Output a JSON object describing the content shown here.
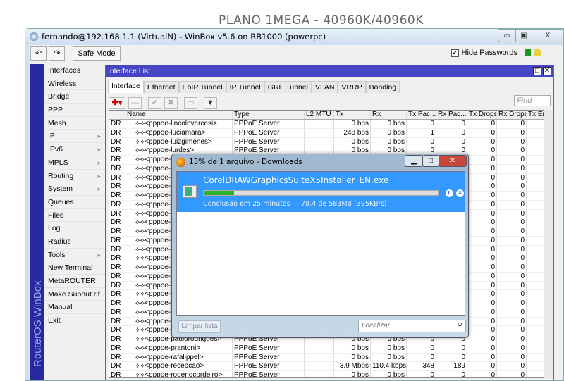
{
  "banner": "PLANO 1MEGA - 40960K/40960K",
  "window": {
    "title": "fernando@192.168.1.1 (VirtualN) - WinBox v5.6 on RB1000 (powerpc)",
    "min": "▭",
    "max": "▣",
    "close": "X"
  },
  "toolbar": {
    "undo": "↶",
    "redo": "↷",
    "safe_mode": "Safe Mode",
    "hide_passwords": "Hide Passwords",
    "check": "✔"
  },
  "side_label": "RouterOS WinBox",
  "menu": [
    {
      "label": "Interfaces"
    },
    {
      "label": "Wireless"
    },
    {
      "label": "Bridge"
    },
    {
      "label": "PPP"
    },
    {
      "label": "Mesh"
    },
    {
      "label": "IP",
      "sub": "▸"
    },
    {
      "label": "IPv6",
      "sub": "▸"
    },
    {
      "label": "MPLS",
      "sub": "▸"
    },
    {
      "label": "Routing",
      "sub": "▸"
    },
    {
      "label": "System",
      "sub": "▸"
    },
    {
      "label": "Queues"
    },
    {
      "label": "Files"
    },
    {
      "label": "Log"
    },
    {
      "label": "Radius"
    },
    {
      "label": "Tools",
      "sub": "▸"
    },
    {
      "label": "New Terminal"
    },
    {
      "label": "MetaROUTER"
    },
    {
      "label": "Make Supout.rif"
    },
    {
      "label": "Manual"
    },
    {
      "label": "Exit"
    }
  ],
  "panel": {
    "title": "Interface List",
    "tabs": [
      "Interface",
      "Ethernet",
      "EoIP Tunnel",
      "IP Tunnel",
      "GRE Tunnel",
      "VLAN",
      "VRRP",
      "Bonding"
    ],
    "find_placeholder": "Find"
  },
  "columns": [
    "",
    "Name",
    "Type",
    "L2 MTU",
    "Tx",
    "Rx",
    "Tx Pac...",
    "Rx Pac...",
    "Tx Drops",
    "Rx Drops",
    "Tx Err"
  ],
  "rows": [
    [
      "DR",
      "⟡⟡<pppoe-lincolnvercesi>",
      "PPPoE Server",
      "",
      "0 bps",
      "0 bps",
      "0",
      "0",
      "0",
      "0"
    ],
    [
      "DR",
      "⟡⟡<pppoe-luciamara>",
      "PPPoE Server",
      "",
      "248 bps",
      "0 bps",
      "1",
      "0",
      "0",
      "0"
    ],
    [
      "DR",
      "⟡⟡<pppoe-luizgimenes>",
      "PPPoE Server",
      "",
      "0 bps",
      "0 bps",
      "0",
      "0",
      "0",
      "0"
    ],
    [
      "DR",
      "⟡⟡<pppoe-lurdes>",
      "PPPoE Server",
      "",
      "0 bps",
      "0 bps",
      "0",
      "0",
      "0",
      "0"
    ],
    [
      "DR",
      "⟡⟡<pppoe-n",
      "",
      "",
      "",
      "",
      "",
      "",
      "0",
      "0"
    ],
    [
      "DR",
      "⟡⟡<pppoe-n",
      "",
      "",
      "",
      "",
      "",
      "",
      "0",
      "0"
    ],
    [
      "DR",
      "⟡⟡<pppoe-n",
      "",
      "",
      "",
      "",
      "",
      "",
      "0",
      "0"
    ],
    [
      "DR",
      "⟡⟡<pppoe-n",
      "",
      "",
      "",
      "",
      "",
      "",
      "0",
      "0"
    ],
    [
      "DR",
      "⟡⟡<pppoe-n",
      "",
      "",
      "",
      "",
      "",
      "",
      "0",
      "0"
    ],
    [
      "DR",
      "⟡⟡<pppoe-n",
      "",
      "",
      "",
      "",
      "",
      "",
      "0",
      "0"
    ],
    [
      "DR",
      "⟡⟡<pppoe-n",
      "",
      "",
      "",
      "",
      "",
      "",
      "0",
      "0"
    ],
    [
      "DR",
      "⟡⟡<pppoe-n",
      "",
      "",
      "",
      "",
      "",
      "",
      "0",
      "0"
    ],
    [
      "DR",
      "⟡⟡<pppoe-n",
      "",
      "",
      "",
      "",
      "",
      "",
      "0",
      "0"
    ],
    [
      "DR",
      "⟡⟡<pppoe-n",
      "",
      "",
      "",
      "",
      "",
      "",
      "0",
      "0"
    ],
    [
      "DR",
      "⟡⟡<pppoe-n",
      "",
      "",
      "",
      "",
      "",
      "",
      "0",
      "0"
    ],
    [
      "DR",
      "⟡⟡<pppoe-n",
      "",
      "",
      "",
      "",
      "",
      "",
      "0",
      "0"
    ],
    [
      "DR",
      "⟡⟡<pppoe-n",
      "",
      "",
      "",
      "",
      "",
      "",
      "0",
      "0"
    ],
    [
      "DR",
      "⟡⟡<pppoe-r",
      "",
      "",
      "",
      "",
      "",
      "",
      "0",
      "0"
    ],
    [
      "DR",
      "⟡⟡<pppoe-r",
      "",
      "",
      "",
      "",
      "",
      "",
      "0",
      "0"
    ],
    [
      "DR",
      "⟡⟡<pppoe-o",
      "",
      "",
      "",
      "",
      "",
      "",
      "0",
      "0"
    ],
    [
      "DR",
      "⟡⟡<pppoe-o",
      "",
      "",
      "",
      "",
      "",
      "",
      "0",
      "0"
    ],
    [
      "DR",
      "⟡⟡<pppoe-p",
      "",
      "",
      "",
      "",
      "",
      "",
      "0",
      "0"
    ],
    [
      "DR",
      "⟡⟡<pppoe-p",
      "",
      "",
      "",
      "",
      "",
      "",
      "0",
      "0"
    ],
    [
      "DR",
      "⟡⟡<pppoe-p",
      "",
      "",
      "",
      "",
      "",
      "",
      "0",
      "0"
    ],
    [
      "DR",
      "⟡⟡<pppoe-paulorodrigues>",
      "PPPoE Server",
      "",
      "0 bps",
      "0 bps",
      "0",
      "0",
      "0",
      "0"
    ],
    [
      "DR",
      "⟡⟡<pppoe-prantoni>",
      "PPPoE Server",
      "",
      "0 bps",
      "0 bps",
      "0",
      "0",
      "0",
      "0"
    ],
    [
      "DR",
      "⟡⟡<pppoe-rafalippel>",
      "PPPoE Server",
      "",
      "0 bps",
      "0 bps",
      "0",
      "0",
      "0",
      "0"
    ],
    [
      "DR",
      "⟡⟡<pppoe-recepcao>",
      "PPPoE Server",
      "",
      "3.9 Mbps",
      "110.4 kbps",
      "348",
      "189",
      "0",
      "0"
    ],
    [
      "DR",
      "⟡⟡<pppoe-rogeriocordeiro>",
      "PPPoE Server",
      "",
      "0 bps",
      "0 bps",
      "0",
      "0",
      "0",
      "0"
    ]
  ],
  "download": {
    "title": "13% de 1 arquivo - Downloads",
    "filename": "CorelDRAWGraphicsSuiteX5Installer_EN.exe",
    "progress_percent": 13,
    "status": "Conclusão em 25 minutos — 78,4 de 583MB (395KB/s)",
    "clear_button": "Limpar lista",
    "search_placeholder": "Localizar",
    "pause": "II",
    "cancel": "✕"
  }
}
